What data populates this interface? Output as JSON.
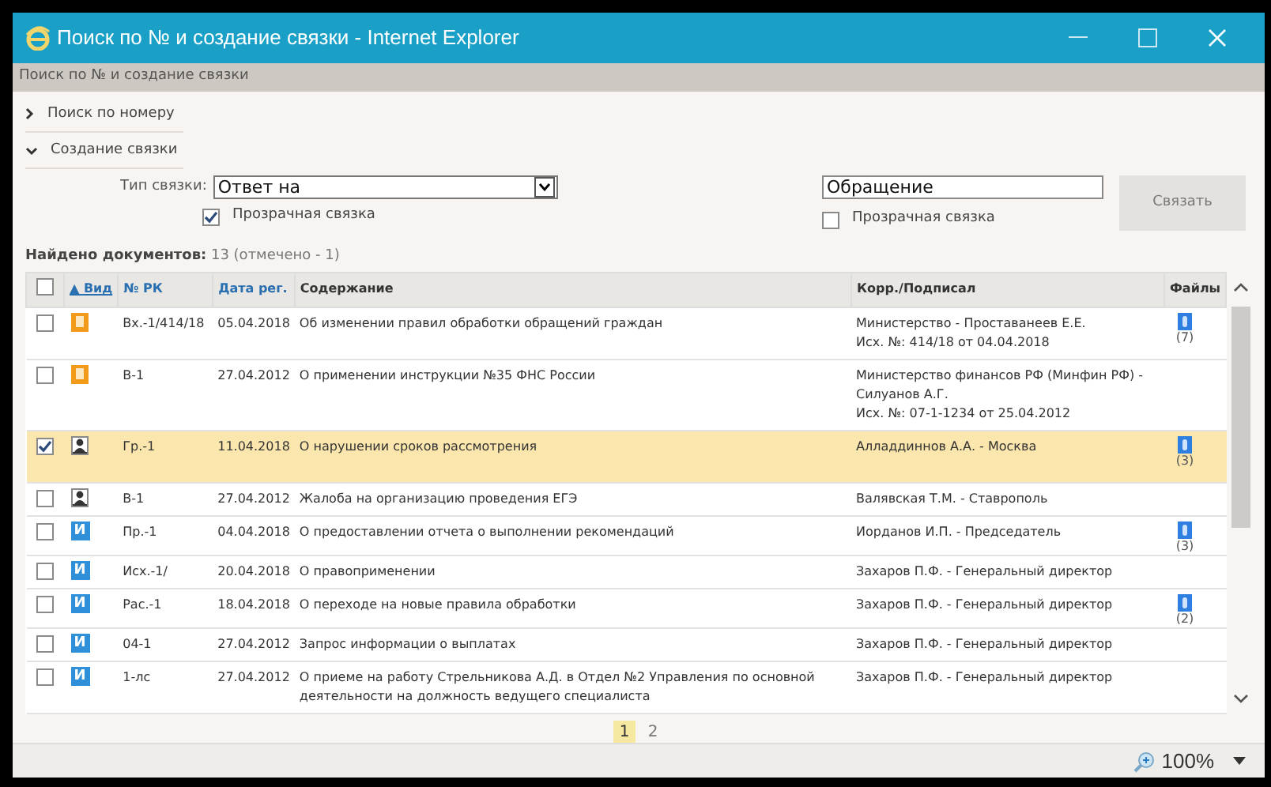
{
  "window": {
    "title": "Поиск по № и создание связки - Internet Explorer"
  },
  "breadcrumb": "Поиск по № и создание связки",
  "sections": [
    {
      "label": "Поиск по номеру",
      "expanded": false
    },
    {
      "label": "Создание связки",
      "expanded": true
    }
  ],
  "link_form": {
    "type_label": "Тип связки:",
    "type_value": "Ответ на",
    "left_transparent": {
      "label": "Прозрачная связка",
      "checked": true
    },
    "target_value": "Обращение",
    "right_transparent": {
      "label": "Прозрачная связка",
      "checked": false
    },
    "button": "Связать"
  },
  "found": {
    "label": "Найдено документов:",
    "count": "13 (отмечено - 1)"
  },
  "table": {
    "select_all": {
      "checked": false
    },
    "columns": [
      "▲ Вид",
      "№ РК",
      "Дата рег.",
      "Содержание",
      "Корр./Подписал",
      "Файлы"
    ],
    "rows": [
      {
        "checked": false,
        "selected": false,
        "kind": "incoming",
        "number": "Вх.-1/414/18",
        "date": "05.04.2018",
        "content": "Об изменении правил обработки обращений граждан",
        "corr": [
          "Министерство - Проставанеев Е.Е.",
          "Исх. №: 414/18 от 04.04.2018"
        ],
        "files": "(7)"
      },
      {
        "checked": false,
        "selected": false,
        "kind": "incoming",
        "number": "В-1",
        "date": "27.04.2012",
        "content": "О применении инструкции №35 ФНС России",
        "corr": [
          "Министерство финансов РФ (Минфин РФ) -",
          "Силуанов А.Г.",
          "Исх. №: 07-1-1234 от 25.04.2012"
        ]
      },
      {
        "checked": true,
        "selected": true,
        "kind": "citizen",
        "number": "Гр.-1",
        "date": "11.04.2018",
        "content": "О нарушении сроков рассмотрения",
        "corr": [
          "Алладдиннов А.А. - Москва"
        ],
        "files": "(3)"
      },
      {
        "checked": false,
        "selected": false,
        "kind": "citizen",
        "number": "В-1",
        "date": "27.04.2012",
        "content": "Жалоба на организацию проведения ЕГЭ",
        "corr": [
          "Валявская Т.М. - Ставрополь"
        ]
      },
      {
        "checked": false,
        "selected": false,
        "kind": "internal",
        "badge": "И",
        "number": "Пр.-1",
        "date": "04.04.2018",
        "content": "О предоставлении отчета о выполнении рекомендаций",
        "corr": [
          "Иорданов И.П. - Председатель"
        ],
        "files": "(3)"
      },
      {
        "checked": false,
        "selected": false,
        "kind": "internal",
        "badge": "И",
        "number": "Исх.-1/",
        "date": "20.04.2018",
        "content": "О правоприменении",
        "corr": [
          "Захаров П.Ф. - Генеральный директор"
        ]
      },
      {
        "checked": false,
        "selected": false,
        "kind": "internal",
        "badge": "И",
        "number": "Рас.-1",
        "date": "18.04.2018",
        "content": "О переходе на новые правила обработки",
        "corr": [
          "Захаров П.Ф. - Генеральный директор"
        ],
        "files": "(2)"
      },
      {
        "checked": false,
        "selected": false,
        "kind": "internal",
        "badge": "И",
        "number": "04-1",
        "date": "27.04.2012",
        "content": "Запрос информации о выплатах",
        "corr": [
          "Захаров П.Ф. - Генеральный директор"
        ]
      },
      {
        "checked": false,
        "selected": false,
        "kind": "internal",
        "badge": "И",
        "number": "1-лс",
        "date": "27.04.2012",
        "content": "О приеме на работу Стрельникова А.Д. в Отдел №2 Управления по основной деятельности на должность ведущего специалиста",
        "corr": [
          "Захаров П.Ф. - Генеральный директор"
        ]
      }
    ]
  },
  "pages": [
    {
      "label": "1",
      "selected": true
    },
    {
      "label": "2",
      "selected": false
    }
  ],
  "status_bar": {
    "zoom": "100%"
  }
}
